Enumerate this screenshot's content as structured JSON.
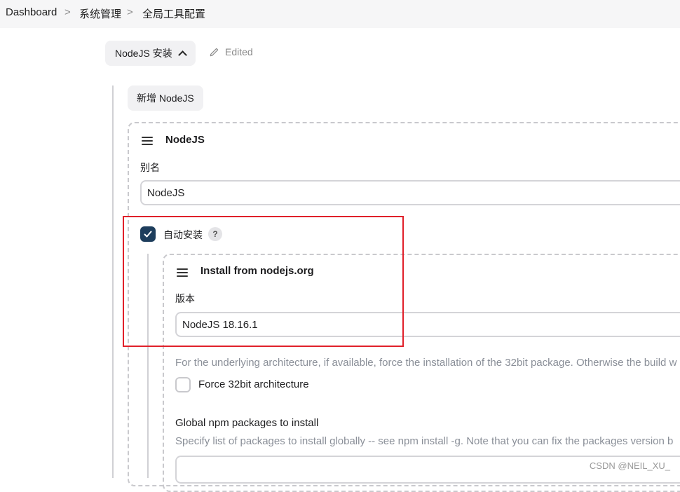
{
  "breadcrumb": {
    "items": [
      "Dashboard",
      "系统管理",
      "全局工具配置"
    ],
    "separator": ">"
  },
  "section": {
    "title": "NodeJS 安装",
    "status": "Edited"
  },
  "add_button": "新增 NodeJS",
  "nodejs_block": {
    "title": "NodeJS",
    "alias_label": "别名",
    "alias_value": "NodeJS",
    "auto_install_label": "自动安装",
    "auto_install_checked": true,
    "help_symbol": "?"
  },
  "installer_block": {
    "title": "Install from nodejs.org",
    "version_label": "版本",
    "version_value": "NodeJS 18.16.1",
    "arch_help": "For the underlying architecture, if available, force the installation of the 32bit package. Otherwise the build w",
    "force32_label": "Force 32bit architecture",
    "force32_checked": false,
    "npm_label": "Global npm packages to install",
    "npm_help": "Specify list of packages to install globally -- see npm install -g. Note that you can fix the packages version b",
    "npm_value": ""
  },
  "watermark": "CSDN @NEIL_XU_",
  "colors": {
    "checkbox_checked": "#1d3d5c",
    "highlight_box": "#e0202a",
    "help_text": "#8a8f98"
  }
}
